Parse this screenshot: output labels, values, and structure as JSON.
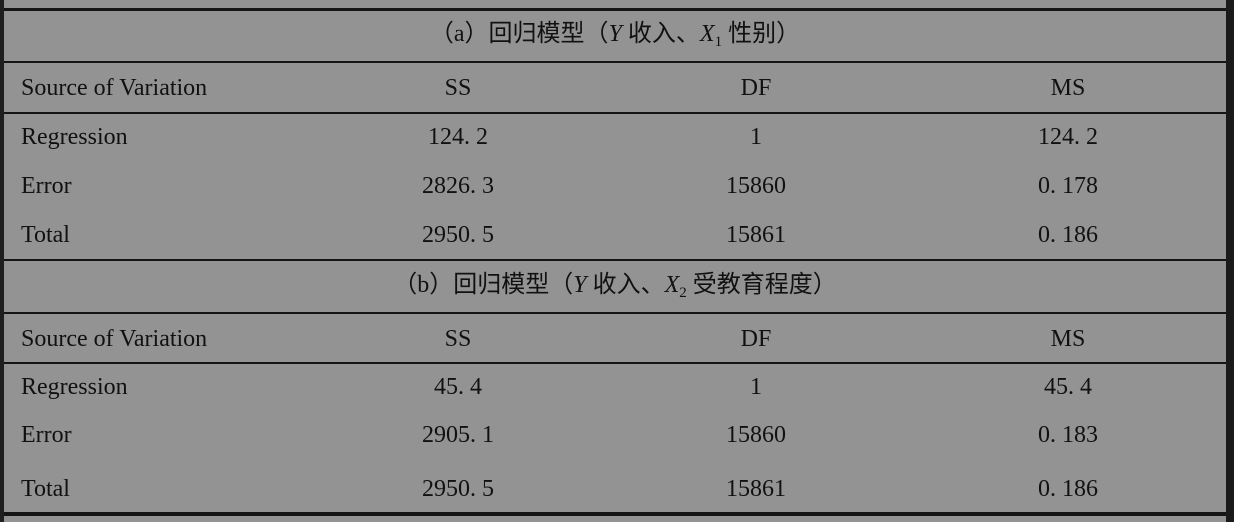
{
  "columns": {
    "source": "Source of Variation",
    "ss": "SS",
    "df": "DF",
    "ms": "MS"
  },
  "panels": [
    {
      "prefix": "（a）回归模型（",
      "y_var": "Y",
      "mid": " 收入、",
      "x_var": "X",
      "x_sub": "1",
      "suffix": " 性别）",
      "rows": [
        {
          "source": "Regression",
          "ss": "124. 2",
          "df": "1",
          "ms": "124. 2"
        },
        {
          "source": "Error",
          "ss": "2826. 3",
          "df": "15860",
          "ms": "0. 178"
        },
        {
          "source": "Total",
          "ss": "2950. 5",
          "df": "15861",
          "ms": "0. 186"
        }
      ]
    },
    {
      "prefix": "（b）回归模型（",
      "y_var": "Y",
      "mid": " 收入、",
      "x_var": "X",
      "x_sub": "2",
      "suffix": " 受教育程度）",
      "rows": [
        {
          "source": "Regression",
          "ss": "45. 4",
          "df": "1",
          "ms": "45. 4"
        },
        {
          "source": "Error",
          "ss": "2905. 1",
          "df": "15860",
          "ms": "0. 183"
        },
        {
          "source": "Total",
          "ss": "2950. 5",
          "df": "15861",
          "ms": "0. 186"
        }
      ]
    }
  ]
}
